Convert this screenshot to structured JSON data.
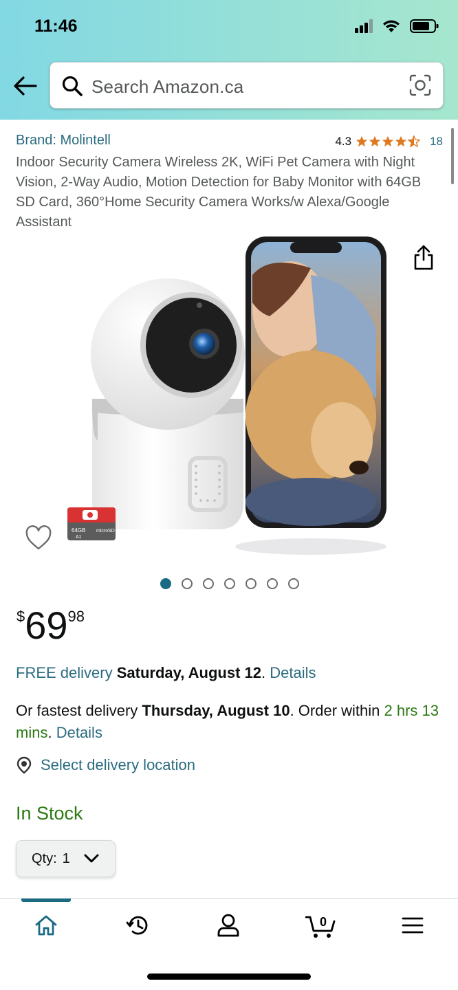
{
  "status_bar": {
    "time": "11:46"
  },
  "search": {
    "placeholder": "Search Amazon.ca"
  },
  "product": {
    "brand": "Brand: Molintell",
    "rating_value": "4.3",
    "rating_count": "18",
    "title": "Indoor Security Camera Wireless 2K, WiFi Pet Camera with Night Vision, 2-Way Audio, Motion Detection for Baby Monitor with 64GB SD Card, 360°Home Security Camera Works/w Alexa/Google Assistant",
    "image_count": 7,
    "active_image_index": 0,
    "sd_card_labels": [
      "64GB",
      "microSD",
      "A1"
    ]
  },
  "price": {
    "symbol": "$",
    "whole": "69",
    "fraction": "98"
  },
  "delivery": {
    "free_prefix": "FREE delivery",
    "free_date": "Saturday, August 12",
    "free_period": ".",
    "details_link": "Details",
    "fastest_prefix": "Or fastest delivery",
    "fastest_date": "Thursday, August 10",
    "order_within_text": ". Order within",
    "time_remaining": "2 hrs 13 mins",
    "fastest_period": ".",
    "location_link": "Select delivery location"
  },
  "stock": {
    "status": "In Stock"
  },
  "quantity": {
    "label": "Qty:",
    "value": "1"
  },
  "bottom_nav": {
    "items": [
      "home-icon",
      "history-icon",
      "account-icon",
      "cart-icon",
      "menu-icon"
    ],
    "cart_count": "0",
    "active_index": 0
  },
  "colors": {
    "link": "#2a6b80",
    "green": "#2b7a12",
    "accent": "#1b6a84",
    "star": "#de7921",
    "header_gradient_start": "#82d8e3",
    "header_gradient_end": "#a6e6ce"
  }
}
